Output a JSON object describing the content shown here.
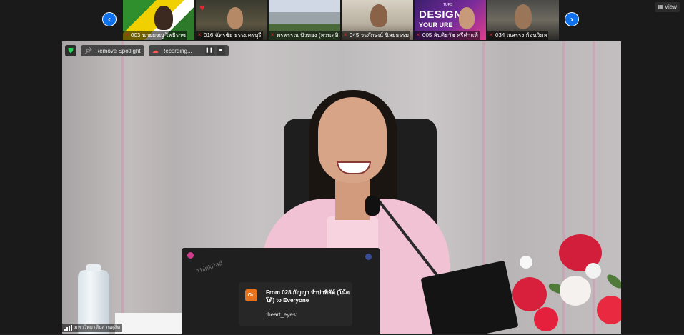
{
  "gallery": {
    "participants": [
      {
        "name": "003 นายผจญ  ไพธิราช"
      },
      {
        "name": "016 ฉัตรชัย ธรรมครบุรี"
      },
      {
        "name": "พรพรรณ ปัวทอง (สวนดุสิ..."
      },
      {
        "name": "045 วรภักษณ์ นิลยธรรม"
      },
      {
        "name": "005 สันติธวัช ศรีคำแท้"
      },
      {
        "name": "034 ณสรรง  ก้อนวิมล"
      }
    ],
    "tile5_text": {
      "design": "DESIGN",
      "your": "YOUR    URE",
      "tups": "TUPS"
    }
  },
  "view_button": {
    "label": "View"
  },
  "icons": {
    "prev": "chevron-left-icon",
    "next": "chevron-right-icon",
    "shield": "shield-icon",
    "pin": "pin-icon",
    "cloud": "cloud-record-icon",
    "pause": "pause-icon",
    "stop": "stop-icon",
    "signal": "signal-icon",
    "heart": "heart-icon"
  },
  "spotlight_controls": {
    "remove_spotlight": "Remove Spotlight",
    "recording": "Recording..."
  },
  "video": {
    "laptop_brand": "ThinkPad"
  },
  "chat_notification": {
    "badge": "On",
    "from": "From 028 กัญญา  จำปาพิลัด์ (โน้ตโต้) to Everyone",
    "message": ":heart_eyes:"
  },
  "active_speaker": {
    "label": "มหาวิทยาลัยสวนดุสิต"
  },
  "colors": {
    "accent": "#0e71eb",
    "recording": "#ff5c5c",
    "shield": "#23d959",
    "chat_badge": "#e8711c"
  }
}
